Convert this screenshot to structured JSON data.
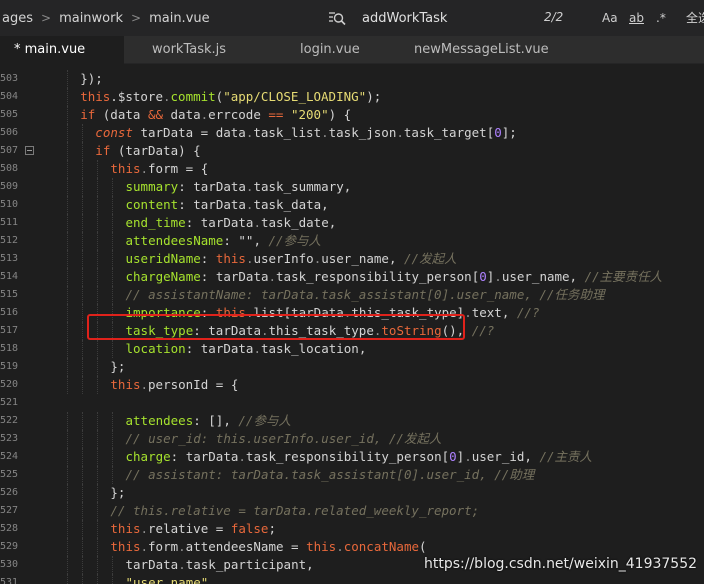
{
  "breadcrumb": [
    "ages",
    "mainwork",
    "main.vue"
  ],
  "search": {
    "value": "addWorkTask",
    "match_count": "2/2",
    "opt_case": "Aa",
    "opt_word": "ab",
    "opt_regex": ".*",
    "all_label": "全选"
  },
  "tabs": [
    {
      "label": "* main.vue",
      "active": true
    },
    {
      "label": "workTask.js",
      "active": false
    },
    {
      "label": "login.vue",
      "active": false
    },
    {
      "label": "newMessageList.vue",
      "active": false
    }
  ],
  "watermark": "https://blog.csdn.net/weixin_41937552",
  "code": [
    {
      "num": "503",
      "indent": 4,
      "tokens": [
        [
          "p",
          "});"
        ]
      ]
    },
    {
      "num": "504",
      "indent": 4,
      "tokens": [
        [
          "kw",
          "this"
        ],
        [
          "p",
          "."
        ],
        [
          "plain",
          "$store"
        ],
        [
          "d",
          "."
        ],
        [
          "prop",
          "commit"
        ],
        [
          "p",
          "("
        ],
        [
          "str",
          "\"app/CLOSE_LOADING\""
        ],
        [
          "p",
          ");"
        ]
      ]
    },
    {
      "num": "505",
      "indent": 4,
      "tokens": [
        [
          "kw",
          "if"
        ],
        [
          "p",
          " (data "
        ],
        [
          "kw",
          "&&"
        ],
        [
          "p",
          " data"
        ],
        [
          "d",
          "."
        ],
        [
          "plain",
          "errcode "
        ],
        [
          "kw",
          "=="
        ],
        [
          "p",
          " "
        ],
        [
          "str",
          "\"200\""
        ],
        [
          "p",
          ") {"
        ]
      ]
    },
    {
      "num": "506",
      "indent": 6,
      "tokens": [
        [
          "it",
          "const"
        ],
        [
          "p",
          " tarData = data"
        ],
        [
          "d",
          "."
        ],
        [
          "plain",
          "task_list"
        ],
        [
          "d",
          "."
        ],
        [
          "plain",
          "task_json"
        ],
        [
          "d",
          "."
        ],
        [
          "plain",
          "task_target"
        ],
        [
          "p",
          "["
        ],
        [
          "num",
          "0"
        ],
        [
          "p",
          "];"
        ]
      ]
    },
    {
      "num": "507",
      "indent": 6,
      "fold": true,
      "tokens": [
        [
          "kw",
          "if"
        ],
        [
          "p",
          " (tarData) {"
        ]
      ]
    },
    {
      "num": "508",
      "indent": 8,
      "tokens": [
        [
          "kw",
          "this"
        ],
        [
          "d",
          "."
        ],
        [
          "plain",
          "form = {"
        ]
      ]
    },
    {
      "num": "509",
      "indent": 10,
      "tokens": [
        [
          "prop",
          "summary"
        ],
        [
          "p",
          ": tarData"
        ],
        [
          "d",
          "."
        ],
        [
          "plain",
          "task_summary,"
        ]
      ]
    },
    {
      "num": "510",
      "indent": 10,
      "tokens": [
        [
          "prop",
          "content"
        ],
        [
          "p",
          ": tarData"
        ],
        [
          "d",
          "."
        ],
        [
          "plain",
          "task_data,"
        ]
      ]
    },
    {
      "num": "511",
      "indent": 10,
      "tokens": [
        [
          "prop",
          "end_time"
        ],
        [
          "p",
          ": tarData"
        ],
        [
          "d",
          "."
        ],
        [
          "plain",
          "task_date,"
        ]
      ]
    },
    {
      "num": "512",
      "indent": 10,
      "tokens": [
        [
          "prop",
          "attendeesName"
        ],
        [
          "p",
          ": \"\", "
        ],
        [
          "cmt",
          "//参与人"
        ]
      ]
    },
    {
      "num": "513",
      "indent": 10,
      "tokens": [
        [
          "prop",
          "useridName"
        ],
        [
          "p",
          ": "
        ],
        [
          "kw",
          "this"
        ],
        [
          "d",
          "."
        ],
        [
          "plain",
          "userInfo"
        ],
        [
          "d",
          "."
        ],
        [
          "plain",
          "user_name, "
        ],
        [
          "cmt",
          "//发起人"
        ]
      ]
    },
    {
      "num": "514",
      "indent": 10,
      "tokens": [
        [
          "prop",
          "chargeName"
        ],
        [
          "p",
          ": tarData"
        ],
        [
          "d",
          "."
        ],
        [
          "plain",
          "task_responsibility_person["
        ],
        [
          "num",
          "0"
        ],
        [
          "p",
          "]"
        ],
        [
          "d",
          "."
        ],
        [
          "plain",
          "user_name, "
        ],
        [
          "cmt",
          "//主要责任人"
        ]
      ]
    },
    {
      "num": "515",
      "indent": 10,
      "tokens": [
        [
          "cmt",
          "// assistantName: tarData.task_assistant[0].user_name, //任务助理"
        ]
      ]
    },
    {
      "num": "516",
      "indent": 10,
      "tokens": [
        [
          "prop",
          "importance"
        ],
        [
          "p",
          ": "
        ],
        [
          "kw",
          "this"
        ],
        [
          "d",
          "."
        ],
        [
          "plain",
          "list[tarData"
        ],
        [
          "d",
          "."
        ],
        [
          "plain",
          "this_task_type]"
        ],
        [
          "d",
          "."
        ],
        [
          "plain",
          "text, "
        ],
        [
          "cmt",
          "//?"
        ]
      ]
    },
    {
      "num": "517",
      "indent": 10,
      "tokens": [
        [
          "prop",
          "task_type"
        ],
        [
          "p",
          ": tarData"
        ],
        [
          "d",
          "."
        ],
        [
          "plain",
          "this_task_type"
        ],
        [
          "d",
          "."
        ],
        [
          "fn",
          "toString"
        ],
        [
          "p",
          "(), "
        ],
        [
          "cmt",
          "//?"
        ]
      ]
    },
    {
      "num": "518",
      "indent": 10,
      "tokens": [
        [
          "prop",
          "location"
        ],
        [
          "p",
          ": tarData"
        ],
        [
          "d",
          "."
        ],
        [
          "plain",
          "task_location,"
        ]
      ]
    },
    {
      "num": "519",
      "indent": 8,
      "tokens": [
        [
          "p",
          "};"
        ]
      ]
    },
    {
      "num": "520",
      "indent": 8,
      "tokens": [
        [
          "kw",
          "this"
        ],
        [
          "d",
          "."
        ],
        [
          "plain",
          "personId = {"
        ]
      ]
    },
    {
      "num": "521",
      "indent": 0,
      "tokens": []
    },
    {
      "num": "522",
      "indent": 10,
      "tokens": [
        [
          "prop",
          "attendees"
        ],
        [
          "p",
          ": [], "
        ],
        [
          "cmt",
          "//参与人"
        ]
      ]
    },
    {
      "num": "523",
      "indent": 10,
      "tokens": [
        [
          "cmt",
          "// user_id: this.userInfo.user_id, //发起人"
        ]
      ]
    },
    {
      "num": "524",
      "indent": 10,
      "tokens": [
        [
          "prop",
          "charge"
        ],
        [
          "p",
          ": tarData"
        ],
        [
          "d",
          "."
        ],
        [
          "plain",
          "task_responsibility_person["
        ],
        [
          "num",
          "0"
        ],
        [
          "p",
          "]"
        ],
        [
          "d",
          "."
        ],
        [
          "plain",
          "user_id, "
        ],
        [
          "cmt",
          "//主责人"
        ]
      ]
    },
    {
      "num": "525",
      "indent": 10,
      "tokens": [
        [
          "cmt",
          "// assistant: tarData.task_assistant[0].user_id, //助理"
        ]
      ]
    },
    {
      "num": "526",
      "indent": 8,
      "tokens": [
        [
          "p",
          "};"
        ]
      ]
    },
    {
      "num": "527",
      "indent": 8,
      "tokens": [
        [
          "cmt",
          "// this.relative = tarData.related_weekly_report;"
        ]
      ]
    },
    {
      "num": "528",
      "indent": 8,
      "tokens": [
        [
          "kw",
          "this"
        ],
        [
          "d",
          "."
        ],
        [
          "plain",
          "relative = "
        ],
        [
          "kw",
          "false"
        ],
        [
          "p",
          ";"
        ]
      ]
    },
    {
      "num": "529",
      "indent": 8,
      "tokens": [
        [
          "kw",
          "this"
        ],
        [
          "d",
          "."
        ],
        [
          "plain",
          "form"
        ],
        [
          "d",
          "."
        ],
        [
          "plain",
          "attendeesName = "
        ],
        [
          "kw",
          "this"
        ],
        [
          "d",
          "."
        ],
        [
          "fn",
          "concatName"
        ],
        [
          "p",
          "("
        ]
      ]
    },
    {
      "num": "530",
      "indent": 10,
      "tokens": [
        [
          "plain",
          "tarData"
        ],
        [
          "d",
          "."
        ],
        [
          "plain",
          "task_participant,"
        ]
      ]
    },
    {
      "num": "531",
      "indent": 10,
      "tokens": [
        [
          "str",
          "\"user_name\""
        ]
      ]
    }
  ]
}
